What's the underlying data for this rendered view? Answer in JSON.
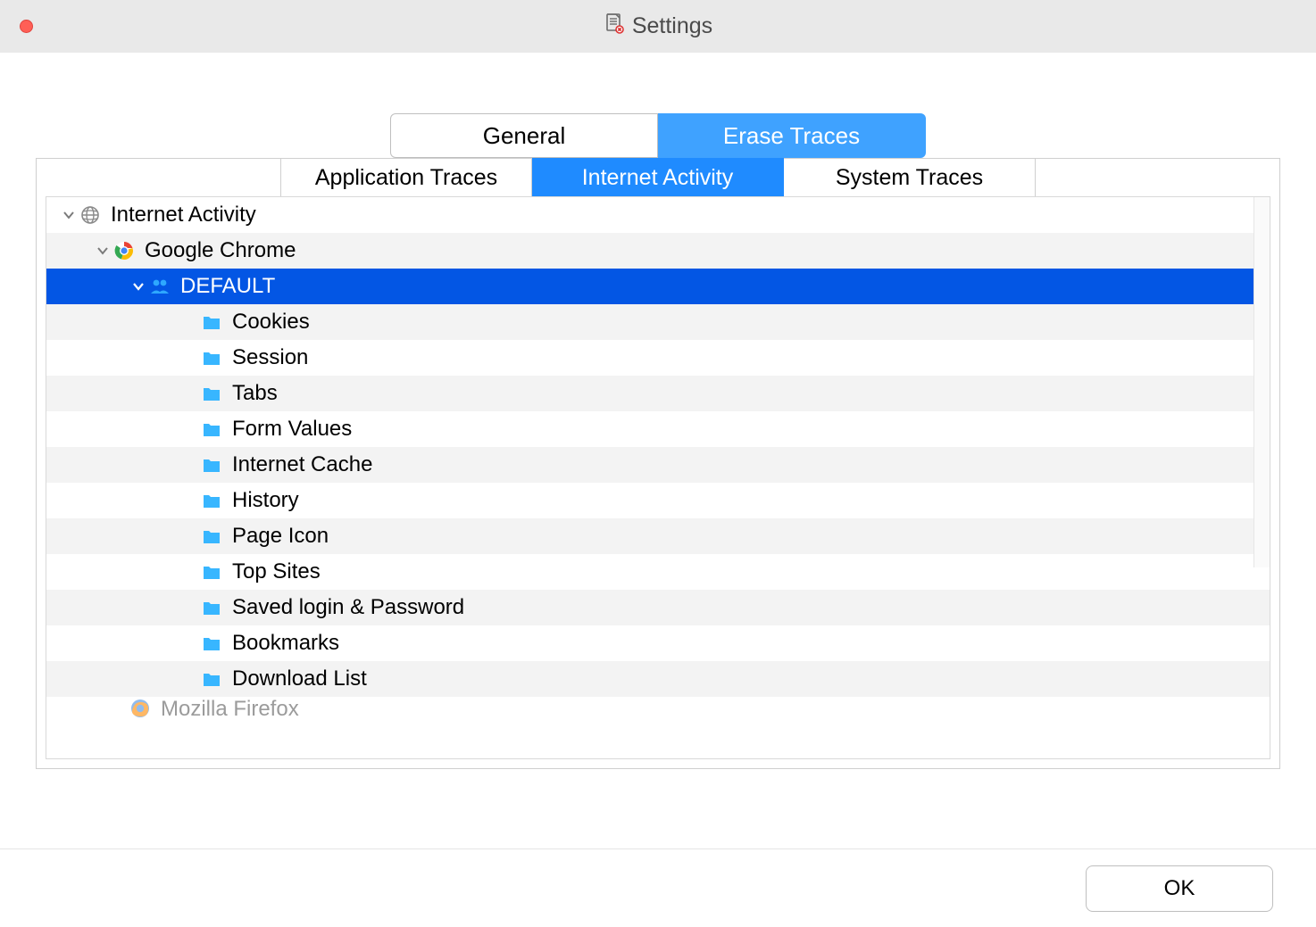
{
  "window": {
    "title": "Settings"
  },
  "topTabs": [
    {
      "label": "General",
      "active": false
    },
    {
      "label": "Erase Traces",
      "active": true
    }
  ],
  "subTabs": [
    {
      "label": "Application Traces",
      "active": false
    },
    {
      "label": "Internet Activity",
      "active": true
    },
    {
      "label": "System Traces",
      "active": false
    }
  ],
  "tree": {
    "root": {
      "label": "Internet Activity"
    },
    "browser": {
      "label": "Google Chrome"
    },
    "profile": {
      "label": "DEFAULT"
    },
    "items": [
      {
        "label": "Cookies"
      },
      {
        "label": "Session"
      },
      {
        "label": "Tabs"
      },
      {
        "label": "Form Values"
      },
      {
        "label": "Internet Cache"
      },
      {
        "label": "History"
      },
      {
        "label": "Page Icon"
      },
      {
        "label": "Top Sites"
      },
      {
        "label": "Saved login & Password"
      },
      {
        "label": "Bookmarks"
      },
      {
        "label": "Download List"
      }
    ],
    "nextBrowser": {
      "label": "Mozilla Firefox"
    }
  },
  "footer": {
    "ok": "OK"
  }
}
